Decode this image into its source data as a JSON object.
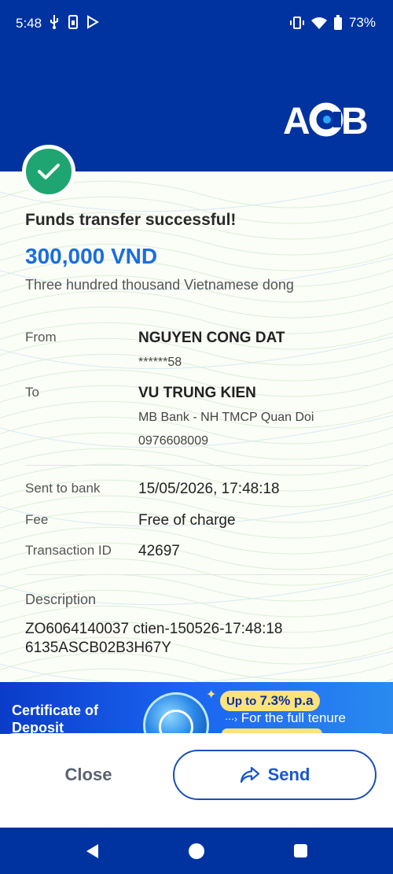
{
  "status_bar": {
    "time": "5:48",
    "battery": "73%",
    "left_icons": [
      "usb-icon",
      "sim-icon",
      "play-store-icon"
    ],
    "right_icons": [
      "vibrate-icon",
      "wifi-icon",
      "battery-icon"
    ]
  },
  "brand": {
    "logo_text": "ACB",
    "color": "#0033a0"
  },
  "receipt": {
    "title": "Funds transfer successful!",
    "amount": "300,000 VND",
    "amount_words": "Three hundred thousand Vietnamese dong",
    "from": {
      "label": "From",
      "name": "NGUYEN CONG DAT",
      "account": "******58"
    },
    "to": {
      "label": "To",
      "name": "VU TRUNG KIEN",
      "bank": "MB Bank - NH TMCP Quan Doi",
      "account": "0976608009"
    },
    "sent_to_bank": {
      "label": "Sent to bank",
      "value": "15/05/2026, 17:48:18"
    },
    "fee": {
      "label": "Fee",
      "value": "Free of charge"
    },
    "transaction_id": {
      "label": "Transaction ID",
      "value": "42697"
    },
    "description": {
      "label": "Description",
      "line1": "ZO6064140037 ctien-150526-17:48:18",
      "line2": "6135ASCB02B3H67Y"
    }
  },
  "banner": {
    "title_line1": "Certificate of",
    "title_line2": "Deposit",
    "rate_prefix": "Up to",
    "rate": "7.3% p.a",
    "rate_sub": "For the full tenure"
  },
  "actions": {
    "close_label": "Close",
    "send_label": "Send"
  },
  "colors": {
    "accent": "#1a6de0",
    "success": "#1fa572",
    "banner_pill": "#ffe27a"
  }
}
